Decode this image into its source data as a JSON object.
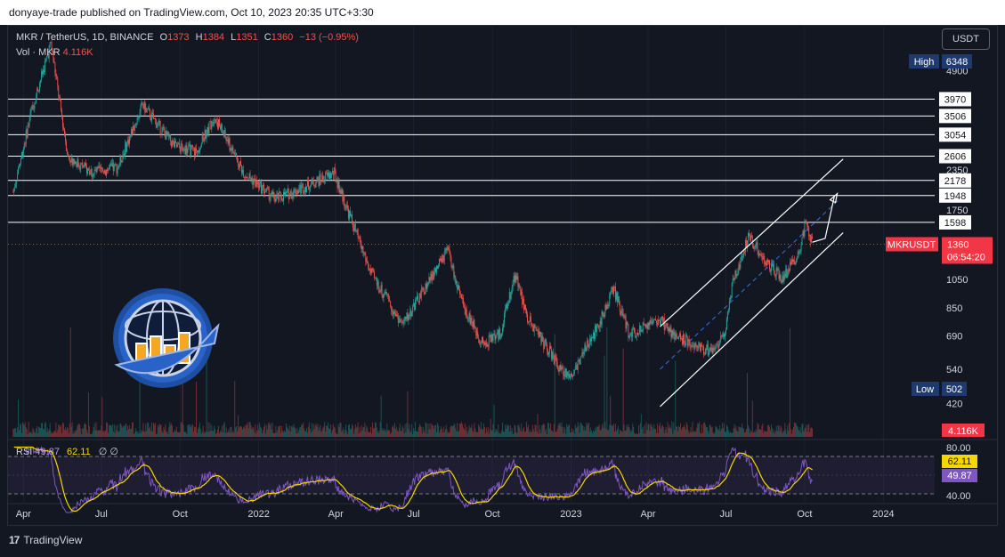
{
  "header": {
    "published": "donyaye-trade published on TradingView.com, Oct 10, 2023 20:35 UTC+3:30"
  },
  "legend": {
    "symbol": "MKR / TetherUS, 1D, BINANCE",
    "open_label": "O",
    "open": "1373",
    "high_label": "H",
    "high": "1384",
    "low_label": "L",
    "low": "1351",
    "close_label": "C",
    "close": "1360",
    "change": "−13 (−0.95%)",
    "vol_label": "Vol · MKR",
    "vol_value": "4.116K"
  },
  "currency_button": "USDT",
  "rsi_legend": {
    "label": "RSI",
    "value_a": "49.87",
    "value_b": "62.11",
    "extra": "∅ ∅"
  },
  "footer": {
    "brand": "TradingView"
  },
  "colors": {
    "background": "#131722",
    "up": "#26a69a",
    "down": "#ef5350",
    "rsi_line": "#7e57c2",
    "rsi_ma": "#f5d700",
    "level": "#ffffff",
    "price_tag": "#f23645"
  },
  "chart_data": {
    "type": "candlestick",
    "symbol": "MKRUSDT",
    "y_scale": "log",
    "time_labels": [
      "Apr",
      "Jul",
      "Oct",
      "2022",
      "Apr",
      "Jul",
      "Oct",
      "2023",
      "Apr",
      "Jul",
      "Oct",
      "2024"
    ],
    "y_tick_labels": [
      "4900",
      "2350",
      "1750",
      "1050",
      "850",
      "690",
      "540",
      "420"
    ],
    "high_tag": {
      "label": "High",
      "value": "6348"
    },
    "low_tag": {
      "label": "Low",
      "value": "502"
    },
    "horizontal_levels": [
      "3970",
      "3506",
      "3054",
      "2606",
      "2178",
      "1948",
      "1598"
    ],
    "current_price": {
      "label": "MKRUSDT",
      "value": "1360",
      "countdown": "06:54:20"
    },
    "volume_tag": "4.116K",
    "price_path": [
      [
        "2021-03-20",
        2000
      ],
      [
        "2021-04-10",
        3600
      ],
      [
        "2021-05-03",
        6000
      ],
      [
        "2021-05-23",
        2600
      ],
      [
        "2021-06-20",
        2300
      ],
      [
        "2021-07-20",
        2400
      ],
      [
        "2021-08-18",
        3800
      ],
      [
        "2021-09-25",
        2800
      ],
      [
        "2021-10-20",
        2700
      ],
      [
        "2021-11-10",
        3500
      ],
      [
        "2021-12-15",
        2300
      ],
      [
        "2022-01-20",
        1900
      ],
      [
        "2022-02-10",
        2000
      ],
      [
        "2022-03-30",
        2300
      ],
      [
        "2022-05-12",
        1100
      ],
      [
        "2022-06-18",
        750
      ],
      [
        "2022-08-10",
        1300
      ],
      [
        "2022-08-25",
        900
      ],
      [
        "2022-09-20",
        650
      ],
      [
        "2022-10-10",
        700
      ],
      [
        "2022-10-28",
        1100
      ],
      [
        "2022-11-10",
        800
      ],
      [
        "2022-12-20",
        540
      ],
      [
        "2022-12-31",
        510
      ],
      [
        "2023-02-01",
        740
      ],
      [
        "2023-02-20",
        980
      ],
      [
        "2023-03-10",
        700
      ],
      [
        "2023-04-15",
        780
      ],
      [
        "2023-05-01",
        700
      ],
      [
        "2023-06-10",
        620
      ],
      [
        "2023-06-28",
        680
      ],
      [
        "2023-07-10",
        1050
      ],
      [
        "2023-07-28",
        1450
      ],
      [
        "2023-08-15",
        1200
      ],
      [
        "2023-09-05",
        1050
      ],
      [
        "2023-09-25",
        1300
      ],
      [
        "2023-10-02",
        1600
      ],
      [
        "2023-10-10",
        1360
      ]
    ],
    "channel": {
      "upper": [
        [
          "2023-04-15",
          740
        ],
        [
          "2023-11-15",
          2550
        ]
      ],
      "lower": [
        [
          "2023-04-15",
          410
        ],
        [
          "2023-11-15",
          1480
        ]
      ],
      "mid": [
        [
          "2023-04-15",
          540
        ],
        [
          "2023-11-10",
          1890
        ]
      ],
      "projection": [
        [
          "2023-10-10",
          1380
        ],
        [
          "2023-10-25",
          1420
        ],
        [
          "2023-11-05",
          1950
        ]
      ]
    },
    "rsi": {
      "levels": [
        "80.00",
        "40.00"
      ],
      "rsi_value": "49.87",
      "ma_value": "62.11"
    }
  }
}
